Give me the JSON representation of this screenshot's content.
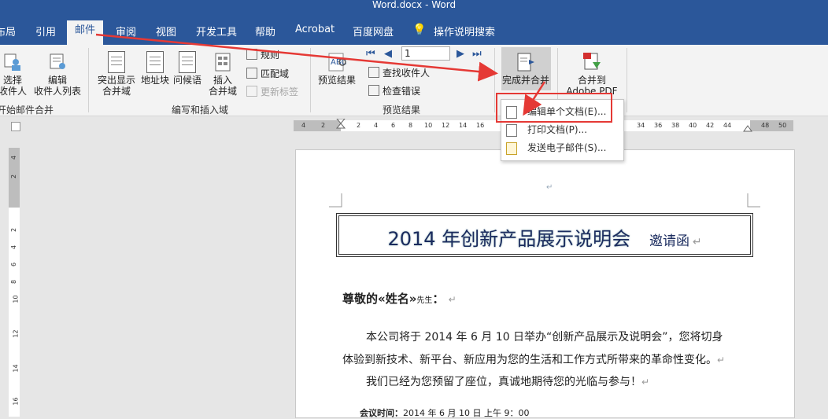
{
  "window": {
    "title": "Word.docx  -  Word"
  },
  "tabs": [
    "布局",
    "引用",
    "邮件",
    "审阅",
    "视图",
    "开发工具",
    "帮助",
    "Acrobat",
    "百度网盘",
    "操作说明搜索"
  ],
  "ribbon": {
    "group_start": {
      "select_recipients": "选择\n收件人",
      "edit_list": "编辑\n收件人列表",
      "label": "开始邮件合并"
    },
    "group_write": {
      "highlight_fields": "突出显示\n合并域",
      "address_block": "地址块",
      "greeting_line": "问候语",
      "insert_field": "插入\n合并域",
      "rules": "规则",
      "match_fields": "匹配域",
      "update_labels": "更新标签",
      "label": "编写和插入域"
    },
    "group_preview": {
      "preview_results": "预览结果",
      "record_number": "1",
      "find_recipient": "查找收件人",
      "check_errors": "检查错误",
      "label": "预览结果"
    },
    "group_finish": {
      "finish_merge": "完成并合并"
    },
    "group_acrobat": {
      "merge_pdf": "合并到\nAdobe PDF"
    }
  },
  "dropdown": {
    "items": [
      "编辑单个文档(E)...",
      "打印文档(P)...",
      "发送电子邮件(S)..."
    ]
  },
  "ruler": {
    "h_ticks": [
      "4",
      "2",
      "2",
      "4",
      "6",
      "8",
      "10",
      "12",
      "14",
      "16",
      "34",
      "36",
      "38",
      "40",
      "42",
      "44",
      "48",
      "50"
    ],
    "v_ticks": [
      "4",
      "2",
      "2",
      "4",
      "6",
      "8",
      "10",
      "12",
      "14",
      "16"
    ]
  },
  "document": {
    "title": "2014 年创新产品展示说明会",
    "title_suffix": "邀请函",
    "greeting": "尊敬的«姓名»",
    "greeting_small": "先生",
    "greeting_end": "：",
    "para1_line1": "本公司将于 2014 年 6 月 10 日举办“创新产品展示及说明会”，您将切身",
    "para1_line2": "体验到新技术、新平台、新应用为您的生活和工作方式所带来的革命性变化。",
    "para2": "我们已经为您预留了座位，真诚地期待您的光临与参与！",
    "meeting_label": "会议时间：",
    "meeting_value": "2014 年 6 月 10 日  上午 9：00"
  },
  "colors": {
    "accent": "#2b579a",
    "highlight": "#e53935"
  }
}
